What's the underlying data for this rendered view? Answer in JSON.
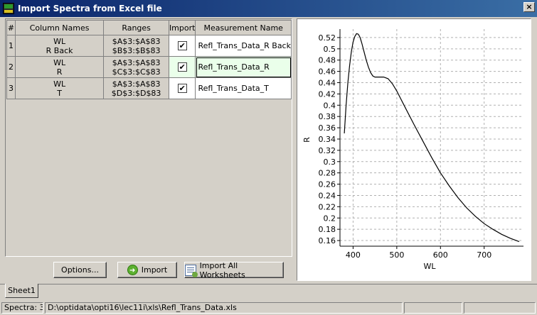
{
  "window": {
    "title": "Import Spectra from Excel file"
  },
  "grid": {
    "headers": [
      "#",
      "Column Names",
      "Ranges",
      "Import",
      "Measurement Name"
    ],
    "rows": [
      {
        "num": "1",
        "col1": "WL",
        "col2": "R Back",
        "range1": "$A$3:$A$83",
        "range2": "$B$3:$B$83",
        "import": true,
        "measurement": "Refl_Trans_Data_R Back"
      },
      {
        "num": "2",
        "col1": "WL",
        "col2": "R",
        "range1": "$A$3:$A$83",
        "range2": "$C$3:$C$83",
        "import": true,
        "measurement": "Refl_Trans_Data_R"
      },
      {
        "num": "3",
        "col1": "WL",
        "col2": "T",
        "range1": "$A$3:$A$83",
        "range2": "$D$3:$D$83",
        "import": true,
        "measurement": "Refl_Trans_Data_T"
      }
    ]
  },
  "buttons": {
    "options": "Options...",
    "import": "Import",
    "import_all": "Import All Worksheets"
  },
  "tabs": [
    "Sheet1"
  ],
  "status": {
    "spectra": "Spectra: 3",
    "path": "D:\\optidata\\opti16\\lec11i\\xls\\Refl_Trans_Data.xls"
  },
  "chart_data": {
    "type": "line",
    "xlabel": "WL",
    "ylabel": "R",
    "xlim": [
      370,
      790
    ],
    "ylim": [
      0.15,
      0.535
    ],
    "xticks": [
      400,
      500,
      600,
      700
    ],
    "yticks": [
      0.16,
      0.18,
      0.2,
      0.22,
      0.24,
      0.26,
      0.28,
      0.3,
      0.32,
      0.34,
      0.36,
      0.38,
      0.4,
      0.42,
      0.44,
      0.46,
      0.48,
      0.5,
      0.52
    ],
    "ytick_labels": [
      "0.16",
      "0.18",
      "0.2",
      "0.22",
      "0.24",
      "0.26",
      "0.28",
      "0.3",
      "0.32",
      "0.34",
      "0.36",
      "0.38",
      "0.4",
      "0.42",
      "0.44",
      "0.46",
      "0.48",
      "0.5",
      "0.52"
    ],
    "grid": true,
    "line_color": "#000000",
    "x": [
      380,
      384,
      388,
      392,
      396,
      400,
      404,
      408,
      412,
      416,
      420,
      425,
      430,
      435,
      440,
      445,
      450,
      460,
      470,
      480,
      490,
      500,
      520,
      540,
      560,
      580,
      600,
      620,
      640,
      660,
      680,
      700,
      720,
      740,
      760,
      780
    ],
    "y": [
      0.35,
      0.4,
      0.44,
      0.47,
      0.495,
      0.512,
      0.522,
      0.527,
      0.526,
      0.52,
      0.51,
      0.495,
      0.48,
      0.468,
      0.458,
      0.452,
      0.45,
      0.45,
      0.45,
      0.447,
      0.438,
      0.425,
      0.395,
      0.365,
      0.336,
      0.307,
      0.28,
      0.257,
      0.236,
      0.218,
      0.203,
      0.19,
      0.18,
      0.171,
      0.164,
      0.158
    ]
  }
}
